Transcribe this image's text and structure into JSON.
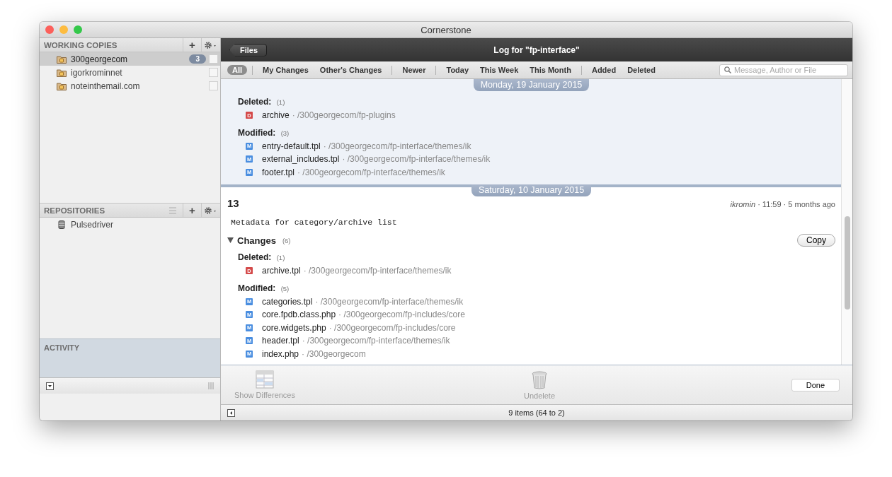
{
  "window": {
    "title": "Cornerstone"
  },
  "sidebar": {
    "working_copies": {
      "title": "WORKING COPIES",
      "add": "+",
      "items": [
        {
          "name": "300georgecom",
          "badge": "3",
          "selected": true,
          "checked": false
        },
        {
          "name": "igorkrominnet",
          "selected": false,
          "checked": false
        },
        {
          "name": "noteinthemail.com",
          "selected": false,
          "checked": false
        }
      ]
    },
    "repositories": {
      "title": "REPOSITORIES",
      "add": "+",
      "items": [
        {
          "name": "Pulsedriver",
          "selected": false
        }
      ]
    },
    "activity": {
      "title": "ACTIVITY"
    }
  },
  "header": {
    "back": "Files",
    "title": "Log for \"fp-interface\""
  },
  "filters": [
    [
      {
        "label": "All",
        "selected": true
      }
    ],
    [
      {
        "label": "My Changes",
        "selected": false
      },
      {
        "label": "Other's Changes",
        "selected": false
      }
    ],
    [
      {
        "label": "Newer",
        "selected": false
      }
    ],
    [
      {
        "label": "Today",
        "selected": false
      },
      {
        "label": "This Week",
        "selected": false
      },
      {
        "label": "This Month",
        "selected": false
      }
    ],
    [
      {
        "label": "Added",
        "selected": false
      },
      {
        "label": "Deleted",
        "selected": false
      }
    ]
  ],
  "search": {
    "placeholder": "Message, Author or File"
  },
  "log": [
    {
      "date": "Monday, 19 January 2015",
      "selected": true,
      "groups": [
        {
          "title": "Deleted:",
          "count": "(1)",
          "files": [
            {
              "kind": "deleted",
              "mark": "D",
              "name": "archive",
              "path": "· /300georgecom/fp-plugins"
            }
          ]
        },
        {
          "title": "Modified:",
          "count": "(3)",
          "files": [
            {
              "kind": "modified",
              "mark": "M",
              "name": "entry-default.tpl",
              "path": "· /300georgecom/fp-interface/themes/ik"
            },
            {
              "kind": "modified",
              "mark": "M",
              "name": "external_includes.tpl",
              "path": "· /300georgecom/fp-interface/themes/ik"
            },
            {
              "kind": "modified",
              "mark": "M",
              "name": "footer.tpl",
              "path": "· /300georgecom/fp-interface/themes/ik"
            }
          ]
        }
      ]
    },
    {
      "date": "Saturday, 10 January 2015",
      "selected": false,
      "revision": "13",
      "author": "ikromin",
      "meta": "· 11:59 · 5 months ago",
      "message": "Metadata for category/archive list",
      "changes": {
        "label": "Changes",
        "count": "(6)",
        "expanded": true,
        "copy": "Copy"
      },
      "groups": [
        {
          "title": "Deleted:",
          "count": "(1)",
          "files": [
            {
              "kind": "deleted",
              "mark": "D",
              "name": "archive.tpl",
              "path": "· /300georgecom/fp-interface/themes/ik"
            }
          ]
        },
        {
          "title": "Modified:",
          "count": "(5)",
          "files": [
            {
              "kind": "modified",
              "mark": "M",
              "name": "categories.tpl",
              "path": "· /300georgecom/fp-interface/themes/ik"
            },
            {
              "kind": "modified",
              "mark": "M",
              "name": "core.fpdb.class.php",
              "path": "· /300georgecom/fp-includes/core"
            },
            {
              "kind": "modified",
              "mark": "M",
              "name": "core.widgets.php",
              "path": "· /300georgecom/fp-includes/core"
            },
            {
              "kind": "modified",
              "mark": "M",
              "name": "header.tpl",
              "path": "· /300georgecom/fp-interface/themes/ik"
            },
            {
              "kind": "modified",
              "mark": "M",
              "name": "index.php",
              "path": "· /300georgecom"
            }
          ]
        }
      ]
    }
  ],
  "toolbar": {
    "buttons": [
      {
        "kind": "diff",
        "label": "Show Differences",
        "disabled": true
      },
      {
        "kind": "undelete",
        "label": "Undelete",
        "disabled": true
      }
    ],
    "done": "Done"
  },
  "status_bar": {
    "text": "9 items (64 to 2)"
  }
}
